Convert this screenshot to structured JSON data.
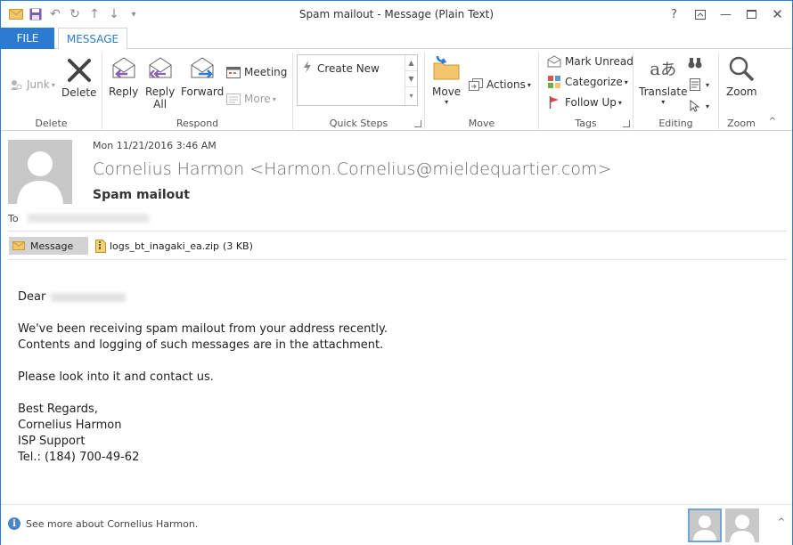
{
  "window": {
    "title": "Spam mailout - Message (Plain Text)"
  },
  "tabs": {
    "file": "FILE",
    "message": "MESSAGE"
  },
  "ribbon": {
    "delete": {
      "label": "Delete",
      "junk": "Junk",
      "delete_btn": "Delete"
    },
    "respond": {
      "label": "Respond",
      "reply": "Reply",
      "reply_all_1": "Reply",
      "reply_all_2": "All",
      "forward": "Forward",
      "meeting": "Meeting",
      "more": "More"
    },
    "quick_steps": {
      "label": "Quick Steps",
      "create_new": "Create New"
    },
    "move": {
      "label": "Move",
      "move_btn": "Move",
      "actions": "Actions"
    },
    "tags": {
      "label": "Tags",
      "mark_unread": "Mark Unread",
      "categorize": "Categorize",
      "follow_up": "Follow Up"
    },
    "editing": {
      "label": "Editing",
      "translate": "Translate"
    },
    "zoom": {
      "label": "Zoom",
      "zoom_btn": "Zoom"
    }
  },
  "message": {
    "date": "Mon 11/21/2016 3:46 AM",
    "sender": "Cornelius Harmon <Harmon.Cornelius@mieldequartier.com>",
    "subject": "Spam mailout",
    "to_label": "To",
    "message_chip": "Message",
    "attachment": {
      "name": "logs_bt_inagaki_ea.zip",
      "size": "(3 KB)"
    },
    "body": {
      "greeting": "Dear",
      "line1": "We've been receiving spam mailout from your address recently.",
      "line2": "Contents and logging of such messages are in the attachment.",
      "line3": "Please look into it and contact us.",
      "sig1": "Best Regards,",
      "sig2": "Cornelius Harmon",
      "sig3": "ISP Support",
      "sig4": "Tel.: (184) 700-49-62"
    }
  },
  "footer": {
    "info": "See more about Cornelius Harmon."
  },
  "colors": {
    "accent": "#2b7bd3",
    "purple_arrow": "#8b5db8",
    "blue_arrow": "#2b7bd3",
    "flag": "#e04343"
  }
}
